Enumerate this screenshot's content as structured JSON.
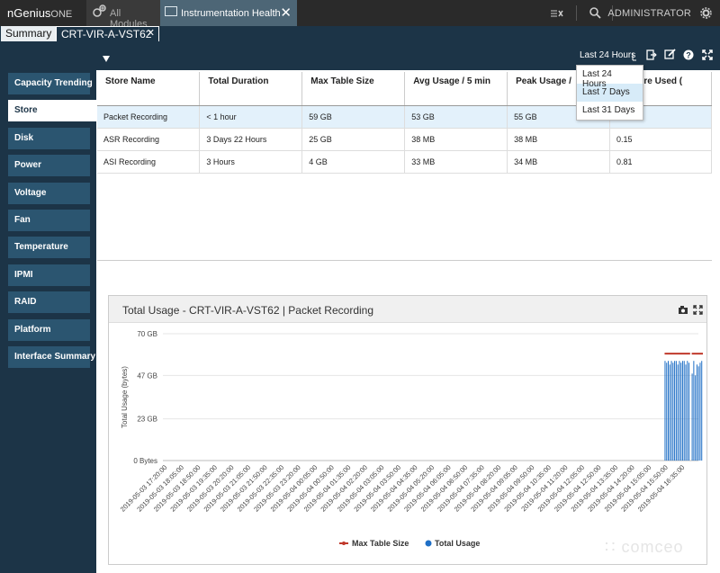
{
  "topbar": {
    "brand": "nGenius",
    "brand_suffix": "ONE",
    "modules_tab": "All Modules",
    "active_tab": "Instrumentation Health",
    "user": "ADMINISTRATOR"
  },
  "tabs": {
    "summary": "Summary",
    "device": "CRT-VIR-A-VST62"
  },
  "toolbar": {
    "range": "Last 24 Hours"
  },
  "range_menu": {
    "items": [
      "Last 24 Hours",
      "Last 7 Days",
      "Last 31 Days"
    ],
    "highlighted": "Last 7 Days"
  },
  "sidebar": {
    "items": [
      "Capacity Trending",
      "Store",
      "Disk",
      "Power",
      "Voltage",
      "Fan",
      "Temperature",
      "IPMI",
      "RAID",
      "Platform",
      "Interface Summary"
    ],
    "active": "Store"
  },
  "table": {
    "columns": [
      "Store Name",
      "Total Duration",
      "Max Table Size",
      "Avg Usage / 5 min",
      "Peak Usage /",
      "nt Store Used ("
    ],
    "rows": [
      [
        "Packet Recording",
        "< 1 hour",
        "59 GB",
        "53 GB",
        "55 GB",
        ""
      ],
      [
        "ASR Recording",
        "3 Days 22 Hours",
        "25 GB",
        "38 MB",
        "38 MB",
        "0.15"
      ],
      [
        "ASI Recording",
        "3 Hours",
        "4 GB",
        "33 MB",
        "34 MB",
        "0.81"
      ]
    ]
  },
  "panel": {
    "title": "Total Usage - CRT-VIR-A-VST62 | Packet Recording"
  },
  "chart_data": {
    "type": "bar",
    "title": "Total Usage - CRT-VIR-A-VST62 | Packet Recording",
    "ylabel": "Total Usage (bytes)",
    "y_ticks": [
      "0 Bytes",
      "23 GB",
      "47 GB",
      "70 GB"
    ],
    "ylim": [
      0,
      70
    ],
    "x_ticks": [
      "2019-05-03 17:20:00",
      "2019-05-03 18:05:00",
      "2019-05-03 18:50:00",
      "2019-05-03 19:35:00",
      "2019-05-03 20:20:00",
      "2019-05-03 21:05:00",
      "2019-05-03 21:50:00",
      "2019-05-03 22:35:00",
      "2019-05-03 23:20:00",
      "2019-05-04 00:05:00",
      "2019-05-04 00:50:00",
      "2019-05-04 01:35:00",
      "2019-05-04 02:20:00",
      "2019-05-04 03:05:00",
      "2019-05-04 03:50:00",
      "2019-05-04 04:35:00",
      "2019-05-04 05:20:00",
      "2019-05-04 06:05:00",
      "2019-05-04 06:50:00",
      "2019-05-04 07:35:00",
      "2019-05-04 08:20:00",
      "2019-05-04 09:05:00",
      "2019-05-04 09:50:00",
      "2019-05-04 10:35:00",
      "2019-05-04 11:20:00",
      "2019-05-04 12:05:00",
      "2019-05-04 12:50:00",
      "2019-05-04 13:35:00",
      "2019-05-04 14:20:00",
      "2019-05-04 15:05:00",
      "2019-05-04 15:50:00",
      "2019-05-04 16:35:00"
    ],
    "series": [
      {
        "name": "Max Table Size",
        "kind": "line",
        "color": "#c0392b",
        "segments": [
          {
            "x_start": "2019-05-04 15:50:00",
            "x_end": "2019-05-04 16:35:00",
            "value": 59
          }
        ]
      },
      {
        "name": "Total Usage",
        "kind": "bar",
        "color": "#1f6fc6",
        "values": [
          55,
          54,
          55,
          53,
          55,
          54,
          55,
          55,
          53,
          55,
          54,
          55,
          55,
          53,
          55,
          54,
          0,
          48,
          55,
          47,
          53,
          52,
          54,
          55
        ]
      }
    ],
    "legend": "bottom-center",
    "grid": true
  }
}
